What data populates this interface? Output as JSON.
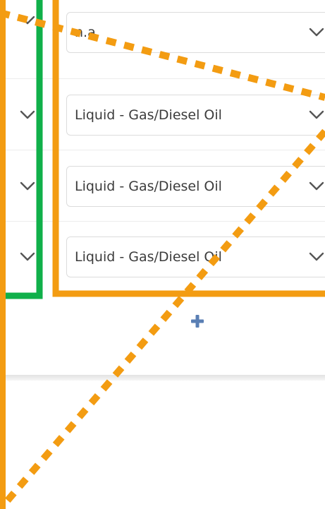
{
  "fuel_rows": [
    {
      "value": "n.a."
    },
    {
      "value": "Liquid - Gas/Diesel Oil"
    },
    {
      "value": "Liquid - Gas/Diesel Oil"
    },
    {
      "value": "Liquid - Gas/Diesel Oil"
    }
  ],
  "icons": {
    "chevron": "chevron-down-icon",
    "add": "plus-icon"
  },
  "colors": {
    "annotation_orange": "#f39c12",
    "annotation_green": "#10b04a",
    "add_blue": "#5a7fb4",
    "text": "#3c3c3c"
  }
}
